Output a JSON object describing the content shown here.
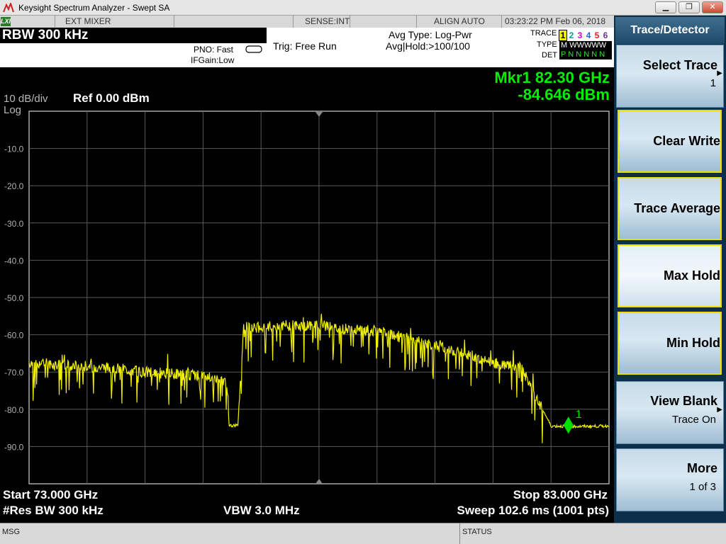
{
  "window": {
    "title": "Keysight Spectrum Analyzer - Swept SA",
    "minimize": "▁",
    "restore": "❐",
    "close": "✕"
  },
  "statusbar": {
    "lxi": "LXI",
    "mixer": "EXT MIXER",
    "sense": "SENSE:INT",
    "align": "ALIGN AUTO",
    "datetime": "03:23:22 PM Feb 06, 2018"
  },
  "settings": {
    "rbw": "RBW 300 kHz",
    "pno": "PNO: Fast",
    "ifgain": "IFGain:Low",
    "trig": "Trig: Free Run",
    "avg_type": "Avg Type: Log-Pwr",
    "avg_hold": "Avg|Hold:>100/100",
    "trace_label": "TRACE",
    "type_label": "TYPE",
    "det_label": "DET",
    "trace_numbers": [
      "1",
      "2",
      "3",
      "4",
      "5",
      "6"
    ],
    "trace_colors": [
      "#000000",
      "#00a0a0",
      "#d000d0",
      "#2060ff",
      "#e02020",
      "#7030a0"
    ],
    "type_value": "M WWWWW",
    "det_value": "P N N N N N"
  },
  "display": {
    "marker_freq": "Mkr1 82.30 GHz",
    "marker_amp": "-84.646 dBm",
    "scale": "10 dB/div",
    "log": "Log",
    "ref": "Ref 0.00 dBm",
    "start": "Start 73.000 GHz",
    "stop": "Stop 83.000 GHz",
    "res_bw": "#Res BW 300 kHz",
    "vbw": "VBW 3.0 MHz",
    "sweep": "Sweep  102.6 ms (1001 pts)",
    "marker_label": "1"
  },
  "chart_data": {
    "type": "line",
    "trace_color": "#f0f000",
    "x_unit": "GHz",
    "y_unit": "dBm",
    "xlim": [
      73.0,
      83.0
    ],
    "ylim": [
      -100,
      0
    ],
    "y_tick_labels": [
      "-10.0",
      "-20.0",
      "-30.0",
      "-40.0",
      "-50.0",
      "-60.0",
      "-70.0",
      "-80.0",
      "-90.0"
    ],
    "grid": true,
    "series": [
      {
        "x": [
          73.0,
          73.5,
          74.0,
          74.5,
          75.0,
          75.5,
          76.0,
          76.2,
          76.4,
          76.45,
          76.5,
          76.55,
          76.6,
          76.7,
          77.0,
          77.5,
          78.0,
          78.5,
          79.0,
          79.5,
          80.0,
          80.5,
          81.0,
          81.5,
          82.0,
          82.5,
          83.0
        ],
        "y": [
          -67.5,
          -68.0,
          -68.5,
          -69.0,
          -70.0,
          -70.5,
          -71.0,
          -71.5,
          -72.5,
          -84.2,
          -84.4,
          -84.3,
          -84.2,
          -57.8,
          -58.0,
          -57.5,
          -57.5,
          -58.5,
          -59.0,
          -61.0,
          -63.0,
          -65.0,
          -67.5,
          -69.0,
          -84.5,
          -84.6,
          -84.5
        ]
      }
    ],
    "marker": {
      "x": 82.3,
      "y": -84.646
    }
  },
  "panel": {
    "title": "Trace/Detector",
    "select_trace": "Select Trace",
    "select_trace_value": "1",
    "clear_write": "Clear Write",
    "trace_average": "Trace Average",
    "max_hold": "Max Hold",
    "min_hold": "Min Hold",
    "view_blank": "View Blank",
    "view_blank_value": "Trace On",
    "more": "More",
    "more_value": "1 of 3"
  },
  "msgbar": {
    "msg": "MSG",
    "status": "STATUS"
  }
}
